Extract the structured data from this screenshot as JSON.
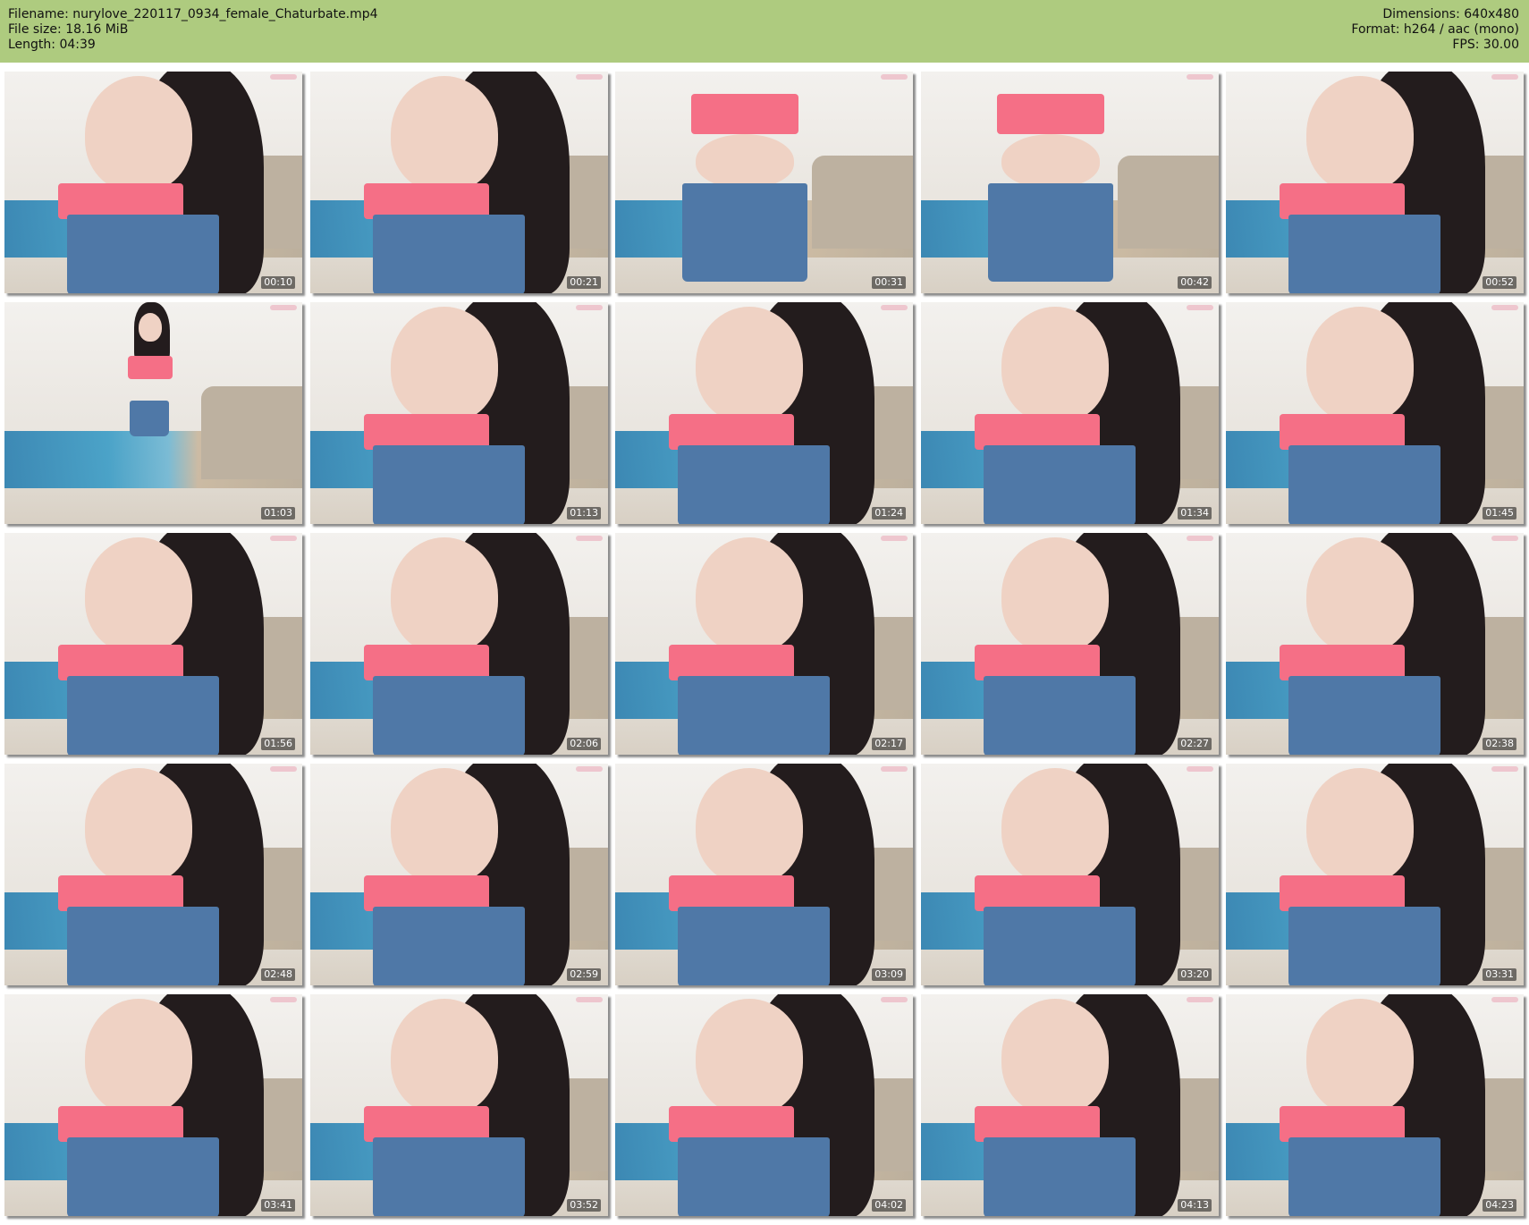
{
  "header": {
    "filename_line": "Filename: nurylove_220117_0934_female_Chaturbate.mp4",
    "filesize_line": "File size: 18.16 MiB",
    "length_line": "Length: 04:39",
    "dimensions_line": "Dimensions: 640x480",
    "format_line": "Format: h264 / aac (mono)",
    "fps_line": "FPS: 30.00",
    "background_color": "#aecb7f"
  },
  "thumbnails": [
    {
      "timestamp": "00:10",
      "scene": "closeup"
    },
    {
      "timestamp": "00:21",
      "scene": "closeup"
    },
    {
      "timestamp": "00:31",
      "scene": "torso"
    },
    {
      "timestamp": "00:42",
      "scene": "torso"
    },
    {
      "timestamp": "00:52",
      "scene": "closeup"
    },
    {
      "timestamp": "01:03",
      "scene": "standing"
    },
    {
      "timestamp": "01:13",
      "scene": "closeup"
    },
    {
      "timestamp": "01:24",
      "scene": "closeup"
    },
    {
      "timestamp": "01:34",
      "scene": "closeup"
    },
    {
      "timestamp": "01:45",
      "scene": "closeup"
    },
    {
      "timestamp": "01:56",
      "scene": "closeup"
    },
    {
      "timestamp": "02:06",
      "scene": "closeup"
    },
    {
      "timestamp": "02:17",
      "scene": "closeup"
    },
    {
      "timestamp": "02:27",
      "scene": "closeup"
    },
    {
      "timestamp": "02:38",
      "scene": "closeup"
    },
    {
      "timestamp": "02:48",
      "scene": "closeup"
    },
    {
      "timestamp": "02:59",
      "scene": "closeup"
    },
    {
      "timestamp": "03:09",
      "scene": "closeup"
    },
    {
      "timestamp": "03:20",
      "scene": "closeup"
    },
    {
      "timestamp": "03:31",
      "scene": "closeup"
    },
    {
      "timestamp": "03:41",
      "scene": "closeup"
    },
    {
      "timestamp": "03:52",
      "scene": "closeup"
    },
    {
      "timestamp": "04:02",
      "scene": "closeup"
    },
    {
      "timestamp": "04:13",
      "scene": "closeup"
    },
    {
      "timestamp": "04:23",
      "scene": "closeup"
    }
  ]
}
